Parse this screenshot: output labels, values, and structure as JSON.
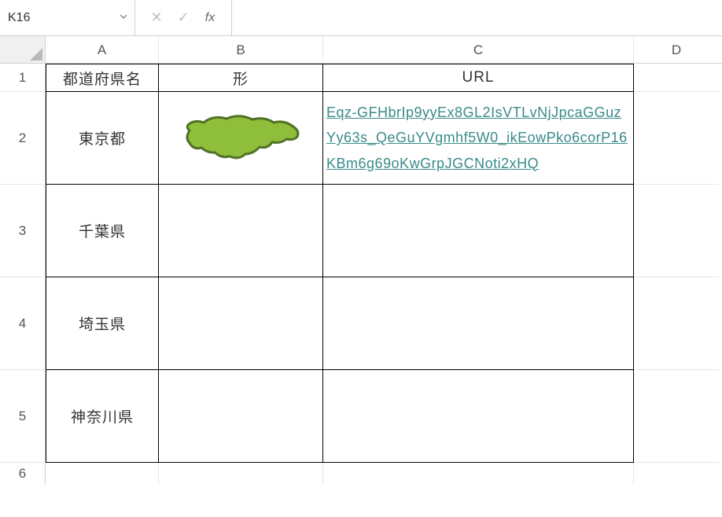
{
  "formula_bar": {
    "namebox_value": "K16",
    "cancel_glyph": "✕",
    "confirm_glyph": "✓",
    "fx_label": "fx",
    "formula_value": ""
  },
  "columns": {
    "A": "A",
    "B": "B",
    "C": "C",
    "D": "D"
  },
  "row_numbers": [
    "1",
    "2",
    "3",
    "4",
    "5",
    "6"
  ],
  "table": {
    "headers": {
      "prefecture": "都道府県名",
      "shape": "形",
      "url": "URL"
    },
    "rows": [
      {
        "prefecture": "東京都",
        "has_shape": true,
        "url": "Eqz-GFHbrIp9yyEx8GL2IsVTLvNjJpcaGGuzYy63s_QeGuYVgmhf5W0_ikEowPko6corP16KBm6g69oKwGrpJGCNoti2xHQ"
      },
      {
        "prefecture": "千葉県",
        "has_shape": false,
        "url": ""
      },
      {
        "prefecture": "埼玉県",
        "has_shape": false,
        "url": ""
      },
      {
        "prefecture": "神奈川県",
        "has_shape": false,
        "url": ""
      }
    ]
  }
}
